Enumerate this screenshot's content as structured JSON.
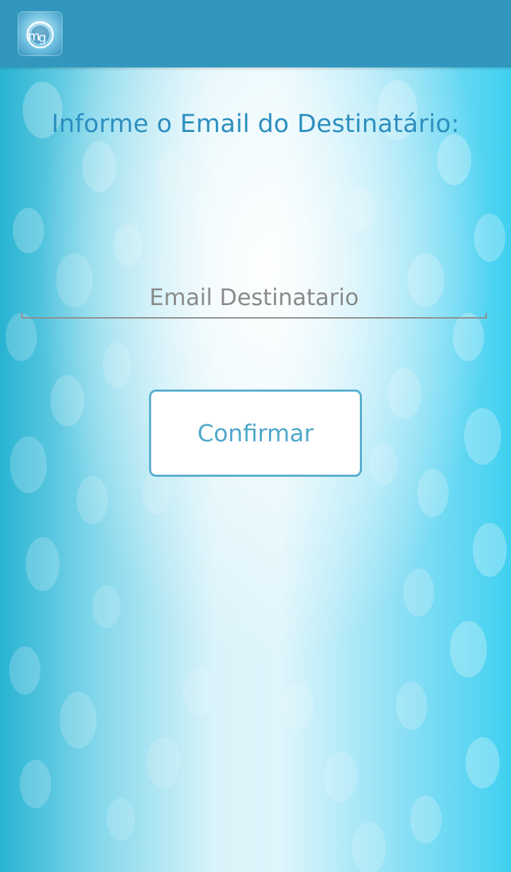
{
  "app": {
    "icon_name": "app-logo-icon",
    "actionbar_color": "#3197be"
  },
  "main": {
    "title": "Informe o Email do Destinatário:",
    "email": {
      "value": "",
      "placeholder": "Email Destinatario"
    },
    "confirm_label": "Confirmar"
  },
  "colors": {
    "accent": "#2d8fbf",
    "button_border": "#5aaed0",
    "button_text": "#4fa8cb"
  }
}
